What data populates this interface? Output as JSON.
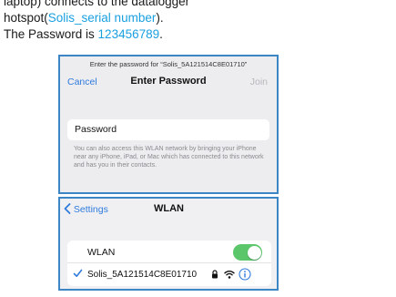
{
  "intro": {
    "line1": "laptop) connects to the datalogger",
    "line2_prefix": "hotspot(",
    "line2_highlight": "Solis_serial number",
    "line2_suffix": ").",
    "line3_prefix": "The Password is ",
    "line3_highlight": "123456789",
    "line3_suffix": "."
  },
  "password_screen": {
    "prompt": "Enter the password for “Solis_5A121514C8E01710”",
    "cancel": "Cancel",
    "title": "Enter Password",
    "join": "Join",
    "password_field": "Password",
    "hint": "You can also access this WLAN network by bringing your iPhone near any iPhone, iPad, or Mac which has connected to this network and has you in their contacts."
  },
  "wlan_screen": {
    "back": "Settings",
    "title": "WLAN",
    "toggle_label": "WLAN",
    "toggle_on": true,
    "network_name": "Solis_5A121514C8E01710"
  },
  "colors": {
    "highlight": "#1aa0e0",
    "panel_border": "#3d86c6",
    "ios_blue": "#2f7bdc",
    "toggle_green": "#5cc66b"
  }
}
